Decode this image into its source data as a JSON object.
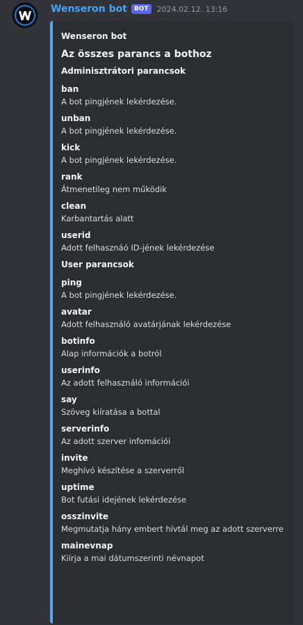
{
  "message": {
    "username": "Wenseron bot",
    "bot_tag": "BOT",
    "timestamp": "2024.02.12. 13:16",
    "avatar_icon": "w-logo-icon"
  },
  "embed": {
    "accent_color": "#5aa6f0",
    "author": "Wenseron bot",
    "title": "Az összes parancs a bothoz",
    "sections": [
      {
        "heading": "Adminisztrátori parancsok",
        "fields": [
          {
            "name": "ban",
            "value": "A bot pingjének lekérdezése."
          },
          {
            "name": "unban",
            "value": "A bot pingjének lekérdezése."
          },
          {
            "name": "kick",
            "value": "A bot pingjének lekérdezése."
          },
          {
            "name": "rank",
            "value": "Átmenetileg nem működik"
          },
          {
            "name": "clean",
            "value": "Karbantartás alatt"
          },
          {
            "name": "userid",
            "value": "Adott felhasznáó ID-jének lekérdezése"
          }
        ]
      },
      {
        "heading": "User parancsok",
        "fields": [
          {
            "name": "ping",
            "value": "A bot pingjének lekérdezése."
          },
          {
            "name": "avatar",
            "value": "Adott felhasználó avatárjának lekérdezése"
          },
          {
            "name": "botinfo",
            "value": "Alap információk a botról"
          },
          {
            "name": "userinfo",
            "value": "Az adott felhasználó információi"
          },
          {
            "name": "say",
            "value": "Szöveg kiíratása a bottal"
          },
          {
            "name": "serverinfo",
            "value": "Az adott szerver infomációi"
          },
          {
            "name": "invite",
            "value": "Meghívó készítése a szerverről"
          },
          {
            "name": "uptime",
            "value": "Bot futási idejének lekérdezése"
          },
          {
            "name": "osszinvite",
            "value": "Megmutatja hány embert hívtál meg az adott szerverre"
          },
          {
            "name": "mainevnap",
            "value": "Kiírja a mai dátumszerinti névnapot"
          }
        ]
      }
    ]
  }
}
